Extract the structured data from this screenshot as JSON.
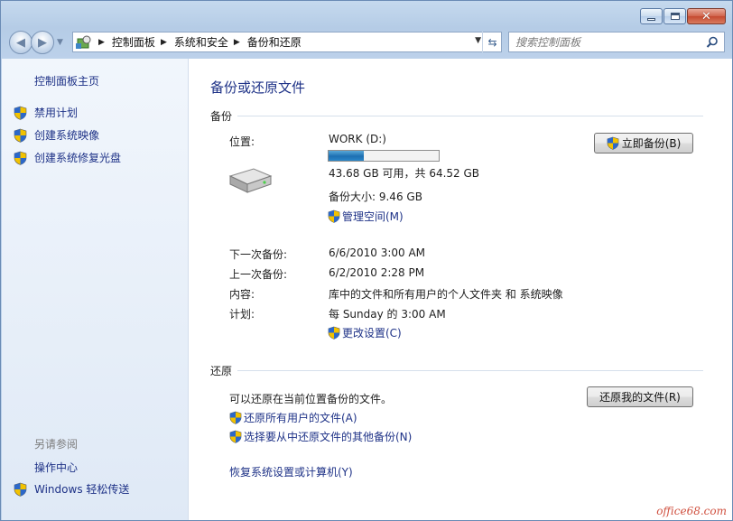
{
  "window": {
    "colors": {
      "accent": "#1e3287",
      "caption_close": "#c44a30",
      "progress": "#1d6fb2"
    }
  },
  "address": {
    "crumbs": [
      "控制面板",
      "系统和安全",
      "备份和还原"
    ]
  },
  "search": {
    "placeholder": "搜索控制面板"
  },
  "sidebar": {
    "home": "控制面板主页",
    "tasks": [
      {
        "label": "禁用计划",
        "icon": "uac-shield-icon"
      },
      {
        "label": "创建系统映像",
        "icon": "uac-shield-icon"
      },
      {
        "label": "创建系统修复光盘",
        "icon": "uac-shield-icon"
      }
    ],
    "see_also_title": "另请参阅",
    "see_also": [
      {
        "label": "操作中心"
      },
      {
        "label": "Windows 轻松传送",
        "icon": "uac-shield-icon"
      }
    ]
  },
  "main": {
    "title": "备份或还原文件",
    "backup": {
      "heading": "备份",
      "location_label": "位置:",
      "drive_name": "WORK (D:)",
      "drive_used_fraction": 0.32,
      "free_space": "43.68 GB 可用，共 64.52 GB",
      "backup_size": "备份大小: 9.46 GB",
      "manage_space": "管理空间(M)",
      "backup_now_button": "立即备份(B)",
      "rows": [
        {
          "label": "下一次备份:",
          "value": "6/6/2010 3:00 AM"
        },
        {
          "label": "上一次备份:",
          "value": "6/2/2010 2:28 PM"
        },
        {
          "label": "内容:",
          "value": "库中的文件和所有用户的个人文件夹 和 系统映像"
        },
        {
          "label": "计划:",
          "value": "每 Sunday 的 3:00 AM"
        }
      ],
      "change_settings": "更改设置(C)"
    },
    "restore": {
      "heading": "还原",
      "description": "可以还原在当前位置备份的文件。",
      "restore_my_files_button": "还原我的文件(R)",
      "restore_all_users": "还原所有用户的文件(A)",
      "select_other_backup": "选择要从中还原文件的其他备份(N)",
      "recover_system": "恢复系统设置或计算机(Y)"
    }
  },
  "watermark": "office68.com"
}
